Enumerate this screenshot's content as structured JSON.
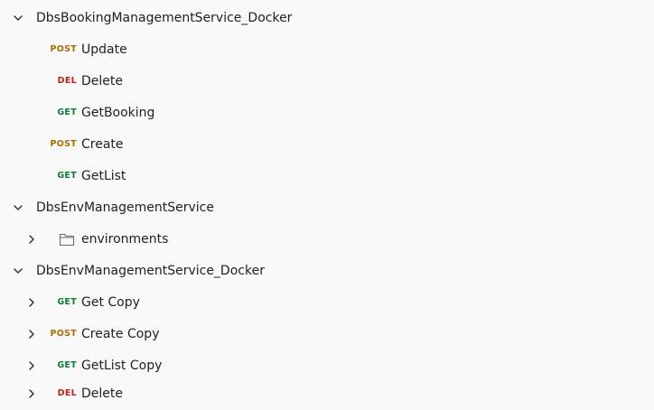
{
  "colors": {
    "get": "#0f7b3b",
    "post": "#a86d00",
    "del": "#b3261e",
    "chevron": "#333333"
  },
  "tree": {
    "collections": [
      {
        "name": "DbsBookingManagementService_Docker",
        "expanded": true,
        "items": [
          {
            "method": "POST",
            "label": "Update"
          },
          {
            "method": "DEL",
            "label": "Delete"
          },
          {
            "method": "GET",
            "label": "GetBooking"
          },
          {
            "method": "POST",
            "label": "Create"
          },
          {
            "method": "GET",
            "label": "GetList"
          }
        ]
      },
      {
        "name": "DbsEnvManagementService",
        "expanded": true,
        "items": [
          {
            "type": "folder",
            "icon": "folder-icon",
            "label": "environments",
            "expanded": false
          }
        ]
      },
      {
        "name": "DbsEnvManagementService_Docker",
        "expanded": true,
        "items": [
          {
            "method": "GET",
            "label": "Get Copy",
            "expanded": false
          },
          {
            "method": "POST",
            "label": "Create Copy",
            "expanded": false
          },
          {
            "method": "GET",
            "label": "GetList Copy",
            "expanded": false
          },
          {
            "method": "DEL",
            "label": "Delete",
            "expanded": false
          }
        ]
      }
    ]
  }
}
